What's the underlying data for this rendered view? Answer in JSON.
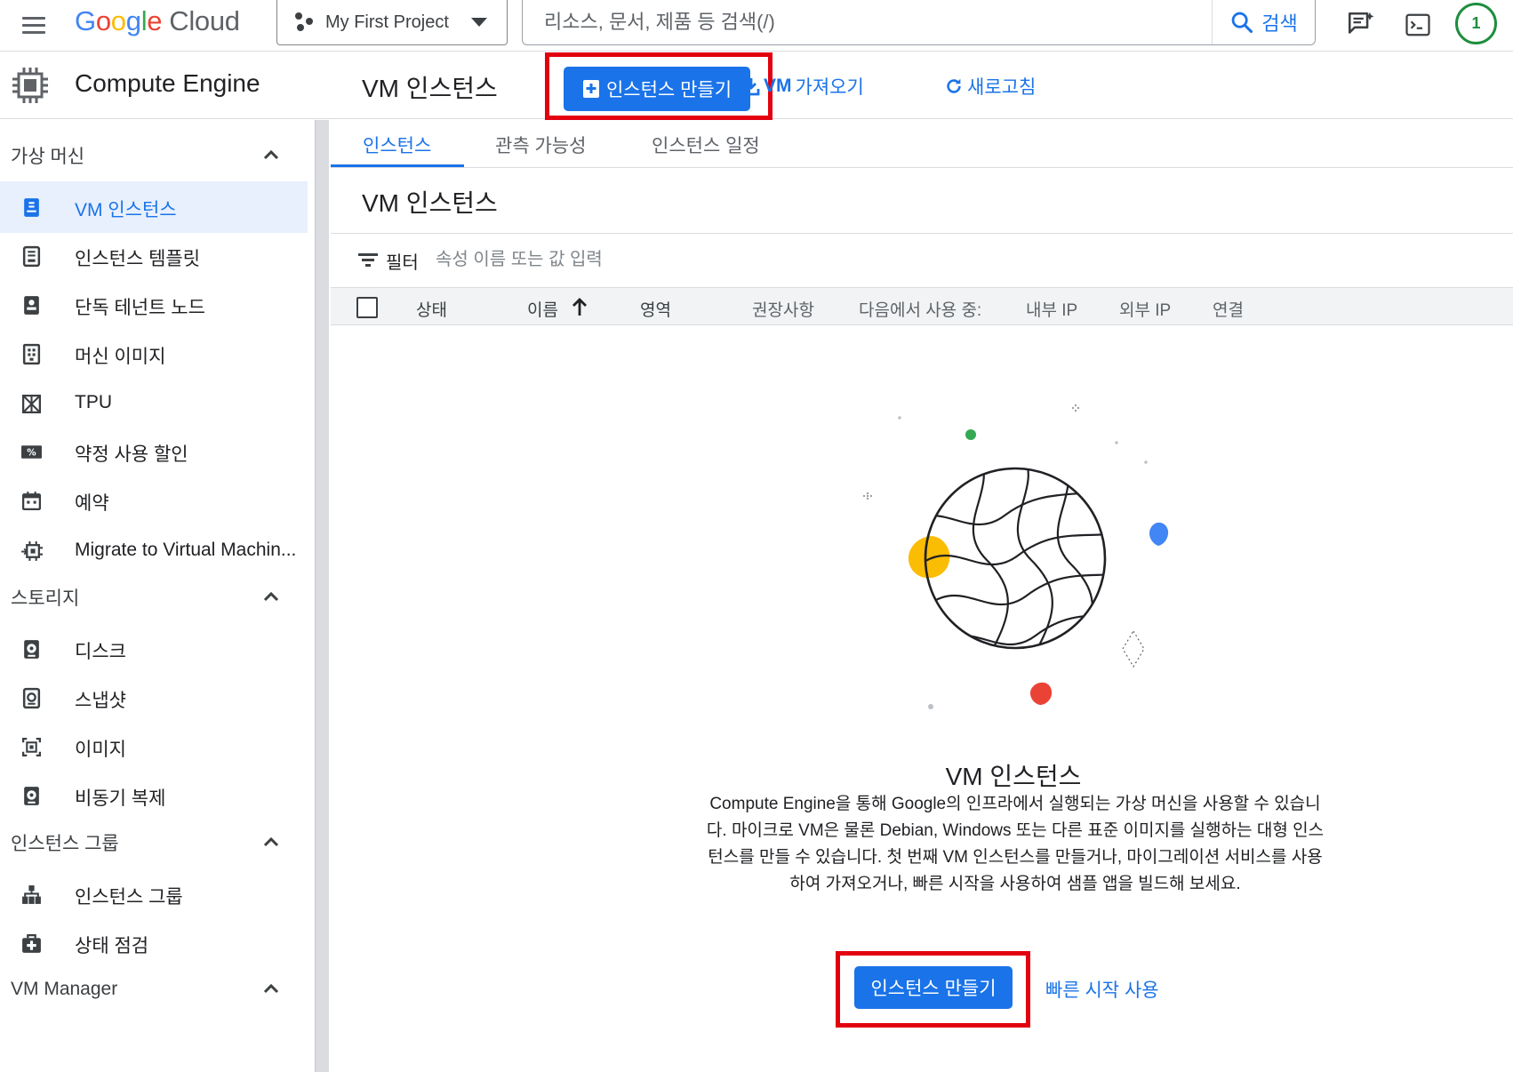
{
  "topbar": {
    "logo_letters": [
      "G",
      "o",
      "o",
      "g",
      "l",
      "e"
    ],
    "logo_suffix": "Cloud",
    "project_name": "My First Project",
    "search_placeholder": "리소스, 문서, 제품 등 검색(/)",
    "search_button": "검색",
    "avatar_initial": "1"
  },
  "sidebar": {
    "product_title": "Compute Engine",
    "sections": [
      {
        "label": "가상 머신"
      },
      {
        "label": "스토리지"
      },
      {
        "label": "인스턴스 그룹"
      },
      {
        "label": "VM Manager"
      }
    ],
    "items": [
      {
        "label": "VM 인스턴스",
        "icon": "vm-instance-icon",
        "active": true
      },
      {
        "label": "인스턴스 템플릿",
        "icon": "template-icon"
      },
      {
        "label": "단독 테넌트 노드",
        "icon": "sole-tenant-icon"
      },
      {
        "label": "머신 이미지",
        "icon": "machine-image-icon"
      },
      {
        "label": "TPU",
        "icon": "tpu-icon"
      },
      {
        "label": "약정 사용 할인",
        "icon": "discount-icon"
      },
      {
        "label": "예약",
        "icon": "calendar-icon"
      },
      {
        "label": "Migrate to Virtual Machin...",
        "icon": "migrate-icon"
      },
      {
        "label": "디스크",
        "icon": "disk-icon"
      },
      {
        "label": "스냅샷",
        "icon": "snapshot-icon"
      },
      {
        "label": "이미지",
        "icon": "image-icon"
      },
      {
        "label": "비동기 복제",
        "icon": "async-replication-icon"
      },
      {
        "label": "인스턴스 그룹",
        "icon": "instance-group-icon"
      },
      {
        "label": "상태 점검",
        "icon": "health-check-icon"
      }
    ]
  },
  "header": {
    "title": "VM 인스턴스",
    "create_button": "인스턴스 만들기",
    "import_link_bold": "VM",
    "import_link_text": "가져오기",
    "refresh_link": "새로고침"
  },
  "tabs": [
    {
      "label": "인스턴스",
      "active": true
    },
    {
      "label": "관측 가능성"
    },
    {
      "label": "인스턴스 일정"
    }
  ],
  "content": {
    "section_title": "VM 인스턴스",
    "filter_label": "필터",
    "filter_placeholder": "속성 이름 또는 값 입력",
    "columns": [
      "상태",
      "이름",
      "영역",
      "권장사항",
      "다음에서 사용 중:",
      "내부 IP",
      "외부 IP",
      "연결"
    ]
  },
  "empty_state": {
    "title": "VM 인스턴스",
    "description": "Compute Engine을 통해 Google의 인프라에서 실행되는 가상 머신을 사용할 수 있습니다. 마이크로 VM은 물론 Debian, Windows 또는 다른 표준 이미지를 실행하는 대형 인스턴스를 만들 수 있습니다. 첫 번째 VM 인스턴스를 만들거나, 마이그레이션 서비스를 사용하여 가져오거나, 빠른 시작을 사용하여 샘플 앱을 빌드해 보세요.",
    "create_button": "인스턴스 만들기",
    "quickstart_link": "빠른 시작 사용"
  },
  "colors": {
    "accent": "#1a73e8",
    "highlight_box": "#e3000f",
    "active_nav_bg": "#e8f0fe"
  }
}
